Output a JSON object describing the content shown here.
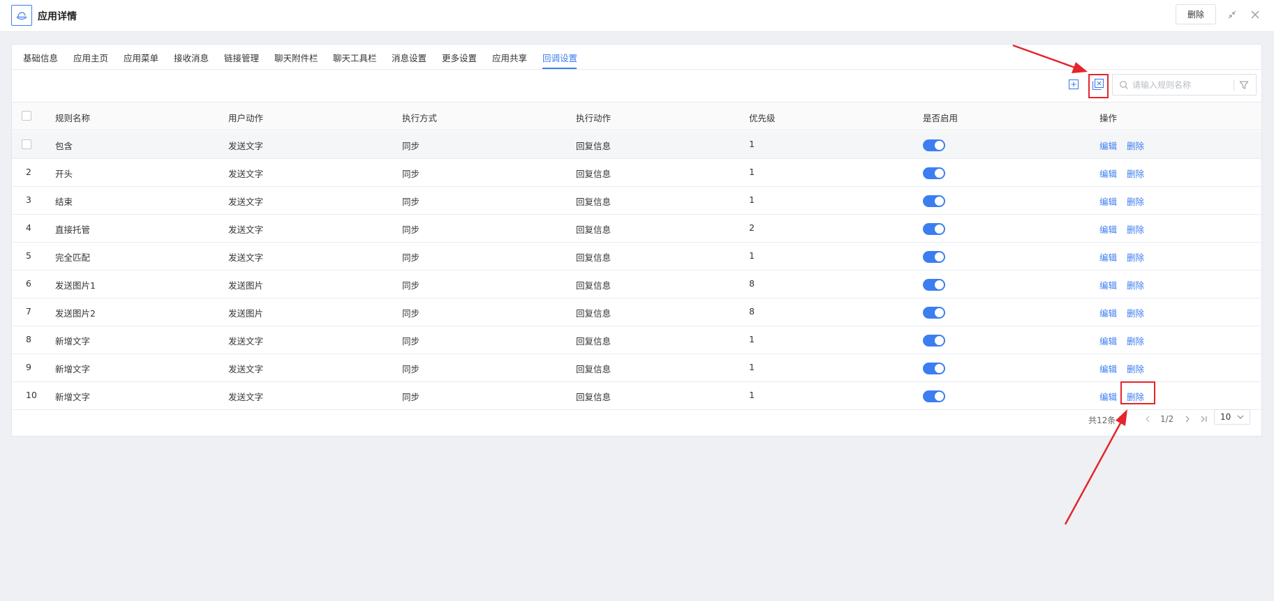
{
  "header": {
    "title": "应用详情",
    "delete_label": "删除"
  },
  "tabs": [
    {
      "label": "基础信息",
      "active": false
    },
    {
      "label": "应用主页",
      "active": false
    },
    {
      "label": "应用菜单",
      "active": false
    },
    {
      "label": "接收消息",
      "active": false
    },
    {
      "label": "链接管理",
      "active": false
    },
    {
      "label": "聊天附件栏",
      "active": false
    },
    {
      "label": "聊天工具栏",
      "active": false
    },
    {
      "label": "消息设置",
      "active": false
    },
    {
      "label": "更多设置",
      "active": false
    },
    {
      "label": "应用共享",
      "active": false
    },
    {
      "label": "回调设置",
      "active": true
    }
  ],
  "toolbar": {
    "search_placeholder": "请输入规则名称",
    "add_icon": "add-icon",
    "export_icon": "export-icon",
    "filter_icon": "filter-icon"
  },
  "table": {
    "columns": [
      "规则名称",
      "用户动作",
      "执行方式",
      "执行动作",
      "优先级",
      "是否启用",
      "操作"
    ],
    "rows": [
      {
        "index": "",
        "name": "包含",
        "user_action": "发送文字",
        "exec_mode": "同步",
        "exec_action": "回复信息",
        "priority": "1",
        "enabled": true,
        "edit": "编辑",
        "delete": "删除"
      },
      {
        "index": "2",
        "name": "开头",
        "user_action": "发送文字",
        "exec_mode": "同步",
        "exec_action": "回复信息",
        "priority": "1",
        "enabled": true,
        "edit": "编辑",
        "delete": "删除"
      },
      {
        "index": "3",
        "name": "结束",
        "user_action": "发送文字",
        "exec_mode": "同步",
        "exec_action": "回复信息",
        "priority": "1",
        "enabled": true,
        "edit": "编辑",
        "delete": "删除"
      },
      {
        "index": "4",
        "name": "直接托管",
        "user_action": "发送文字",
        "exec_mode": "同步",
        "exec_action": "回复信息",
        "priority": "2",
        "enabled": true,
        "edit": "编辑",
        "delete": "删除"
      },
      {
        "index": "5",
        "name": "完全匹配",
        "user_action": "发送文字",
        "exec_mode": "同步",
        "exec_action": "回复信息",
        "priority": "1",
        "enabled": true,
        "edit": "编辑",
        "delete": "删除"
      },
      {
        "index": "6",
        "name": "发送图片1",
        "user_action": "发送图片",
        "exec_mode": "同步",
        "exec_action": "回复信息",
        "priority": "8",
        "enabled": true,
        "edit": "编辑",
        "delete": "删除"
      },
      {
        "index": "7",
        "name": "发送图片2",
        "user_action": "发送图片",
        "exec_mode": "同步",
        "exec_action": "回复信息",
        "priority": "8",
        "enabled": true,
        "edit": "编辑",
        "delete": "删除"
      },
      {
        "index": "8",
        "name": "新增文字",
        "user_action": "发送文字",
        "exec_mode": "同步",
        "exec_action": "回复信息",
        "priority": "1",
        "enabled": true,
        "edit": "编辑",
        "delete": "删除"
      },
      {
        "index": "9",
        "name": "新增文字",
        "user_action": "发送文字",
        "exec_mode": "同步",
        "exec_action": "回复信息",
        "priority": "1",
        "enabled": true,
        "edit": "编辑",
        "delete": "删除"
      },
      {
        "index": "10",
        "name": "新增文字",
        "user_action": "发送文字",
        "exec_mode": "同步",
        "exec_action": "回复信息",
        "priority": "1",
        "enabled": true,
        "edit": "编辑",
        "delete": "删除"
      }
    ]
  },
  "pagination": {
    "total": "共12条",
    "page": "1/2",
    "page_size": "10"
  },
  "colors": {
    "accent": "#3c7ef0",
    "annotation": "#e5242b"
  }
}
